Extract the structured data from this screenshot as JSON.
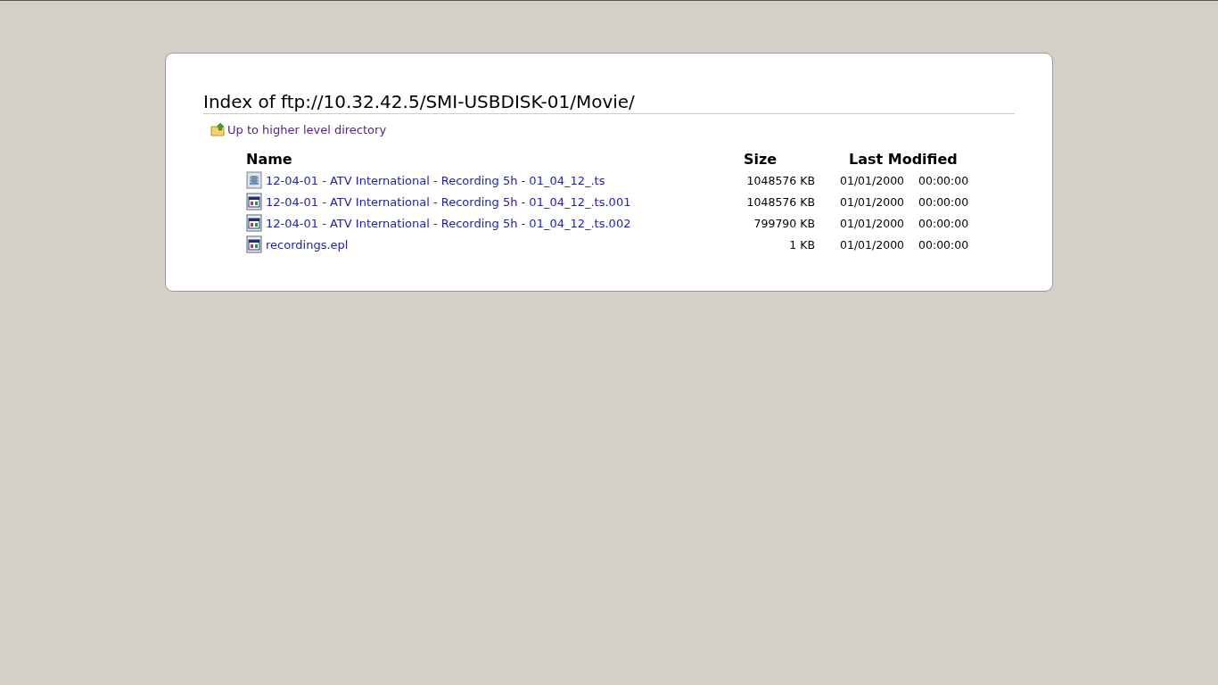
{
  "title": "Index of ftp://10.32.42.5/SMI-USBDISK-01/Movie/",
  "up_link": "Up to higher level directory",
  "table": {
    "columns": [
      "Name",
      "Size",
      "Last Modified"
    ],
    "rows": [
      {
        "kind": "video",
        "name": "12-04-01 - ATV International - Recording 5h - 01_04_12_.ts",
        "size": "1048576 KB",
        "date": "01/01/2000",
        "time": "00:00:00"
      },
      {
        "kind": "file",
        "name": "12-04-01 - ATV International - Recording 5h - 01_04_12_.ts.001",
        "size": "1048576 KB",
        "date": "01/01/2000",
        "time": "00:00:00"
      },
      {
        "kind": "file",
        "name": "12-04-01 - ATV International - Recording 5h - 01_04_12_.ts.002",
        "size": "799790 KB",
        "date": "01/01/2000",
        "time": "00:00:00"
      },
      {
        "kind": "file",
        "name": "recordings.epl",
        "size": "1 KB",
        "date": "01/01/2000",
        "time": "00:00:00"
      }
    ]
  }
}
